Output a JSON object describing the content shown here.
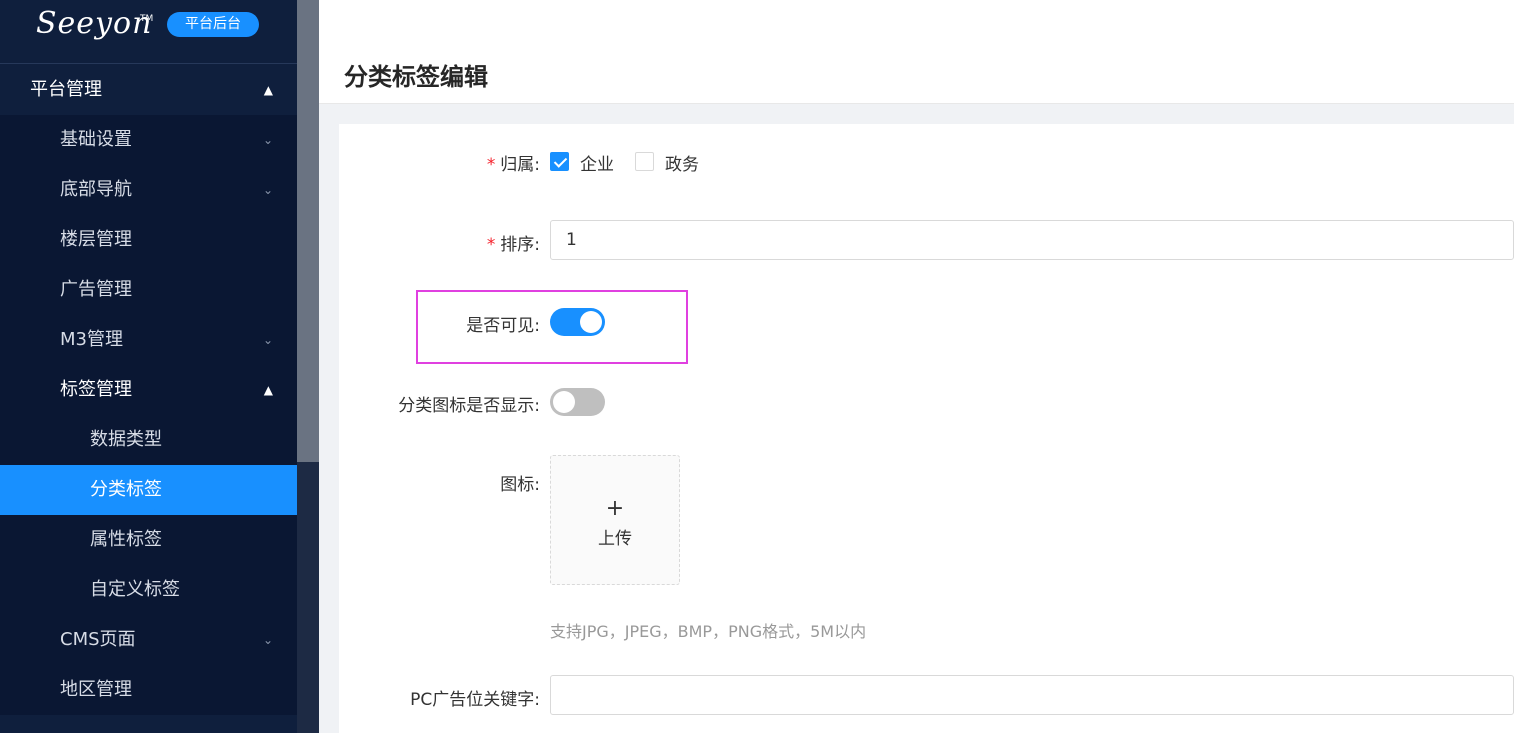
{
  "sidebar": {
    "logo": "Seeyon",
    "logo_tm": "TM",
    "badge": "平台后台",
    "menu": {
      "platform": "平台管理",
      "basic": "基础设置",
      "bottom_nav": "底部导航",
      "floor": "楼层管理",
      "ad": "广告管理",
      "m3": "M3管理",
      "tags": "标签管理",
      "data_type": "数据类型",
      "category_tag": "分类标签",
      "attr_tag": "属性标签",
      "custom_tag": "自定义标签",
      "cms": "CMS页面",
      "region": "地区管理"
    }
  },
  "page": {
    "title": "分类标签编辑"
  },
  "form": {
    "required_mark": "*",
    "owner_label": "归属:",
    "owner_options": [
      "企业",
      "政务"
    ],
    "owner_checked": [
      true,
      false
    ],
    "sort_label": "排序:",
    "sort_value": "1",
    "visible_label": "是否可见:",
    "visible_on": true,
    "icon_show_label": "分类图标是否显示:",
    "icon_show_on": false,
    "icon_label": "图标:",
    "upload_plus": "+",
    "upload_text": "上传",
    "upload_hint": "支持JPG，JPEG，BMP，PNG格式，5M以内",
    "pc_keyword_label": "PC广告位关键字:",
    "pc_keyword_value": ""
  },
  "colors": {
    "sidebar_bg": "#0f1f3d",
    "accent": "#1890ff",
    "highlight": "#e040e0",
    "required": "#f5222d"
  }
}
